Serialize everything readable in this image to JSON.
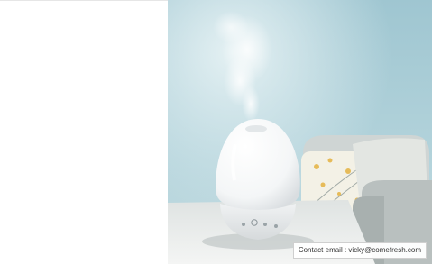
{
  "photo": {
    "subject": "egg-shaped white ultrasonic aroma diffuser emitting mist",
    "colors": {
      "wall": "#a9cdd6",
      "window_light": "#dfeef2",
      "table": "#eef0ef",
      "device": "#ffffff",
      "sofa": "#d4d8d6",
      "pillow": "#f4f2e8"
    }
  },
  "contact": {
    "text": "Contact email : vicky@comefresh.com"
  }
}
